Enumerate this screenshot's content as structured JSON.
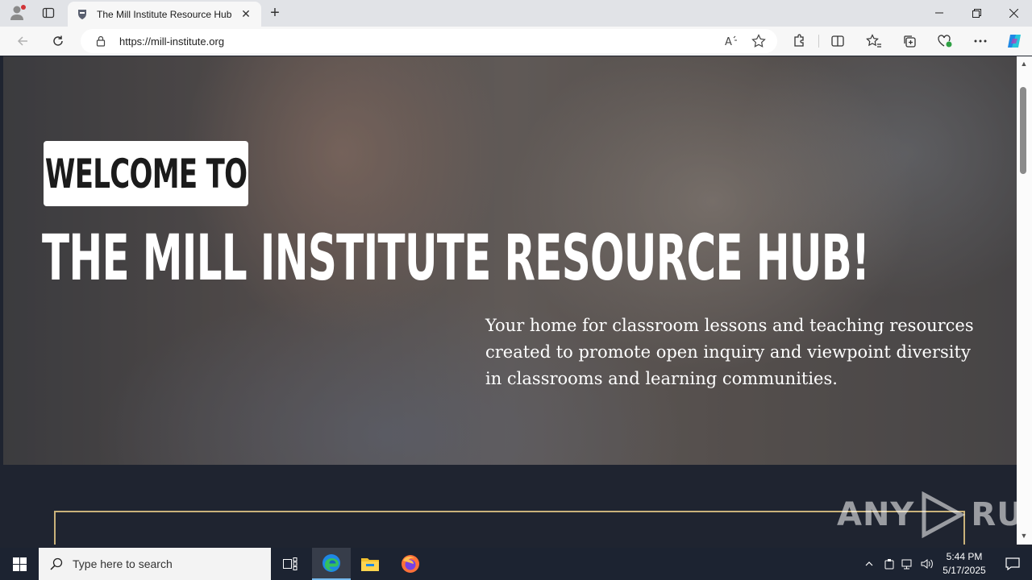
{
  "browser": {
    "tab_title": "The Mill Institute Resource Hub",
    "url": "https://mill-institute.org",
    "icons": [
      "profile-icon",
      "tab-actions-icon",
      "tab-favicon",
      "close-icon",
      "new-tab-icon",
      "back-icon",
      "refresh-icon",
      "lock-icon",
      "read-aloud-icon",
      "favorite-star-icon",
      "extensions-icon",
      "split-screen-icon",
      "favorites-icon",
      "collections-icon",
      "browser-essentials-icon",
      "more-icon",
      "copilot-icon",
      "minimize-icon",
      "restore-icon",
      "close-window-icon"
    ]
  },
  "page": {
    "welcome": "WELCOME TO",
    "headline": "THE MILL INSTITUTE RESOURCE HUB!",
    "subtext": "Your home for classroom lessons and teaching resources created to promote open inquiry and viewpoint diversity in classrooms and learning communities.",
    "accent_color": "#c9b27a",
    "dark_bg": "#1f2430"
  },
  "watermark": {
    "left": "ANY",
    "right": "RUN"
  },
  "taskbar": {
    "search_placeholder": "Type here to search",
    "time": "5:44 PM",
    "date": "5/17/2025",
    "apps": [
      "task-view-icon",
      "edge-icon",
      "file-explorer-icon",
      "firefox-icon"
    ]
  }
}
